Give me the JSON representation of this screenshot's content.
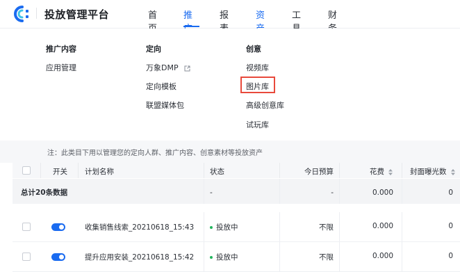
{
  "header": {
    "app_title": "投放管理平台",
    "nav": [
      "首页",
      "推广",
      "报表",
      "资产",
      "工具",
      "财务"
    ],
    "active_index": 1,
    "accent_color": "#1a6bf0"
  },
  "menu": {
    "columns": [
      {
        "title": "推广内容",
        "items": [
          "应用管理"
        ]
      },
      {
        "title": "定向",
        "items": [
          "万象DMP",
          "定向模板",
          "联盟媒体包"
        ]
      },
      {
        "title": "创意",
        "items": [
          "视频库",
          "图片库",
          "高级创意库",
          "试玩库"
        ]
      }
    ],
    "external_link_item": "万象DMP",
    "highlighted_item": "图片库"
  },
  "note": "注：此类目下用以管理您的定向人群、推广内容、创意素材等投放资产",
  "table": {
    "headers": [
      "开关",
      "计划名称",
      "状态",
      "今日预算",
      "花费",
      "封面曝光数"
    ],
    "total_row": {
      "label": "总计20条数据",
      "status": "-",
      "budget": "-",
      "cost": "0.000",
      "exposure": "0"
    },
    "rows": [
      {
        "name": "收集销售线索_20210618_15:43",
        "status": "投放中",
        "budget": "不限",
        "cost": "0.000",
        "exposure": "0",
        "switch_on": true
      },
      {
        "name": "提升应用安装_20210618_15:42",
        "status": "投放中",
        "budget": "不限",
        "cost": "0.000",
        "exposure": "0",
        "switch_on": true
      }
    ]
  }
}
